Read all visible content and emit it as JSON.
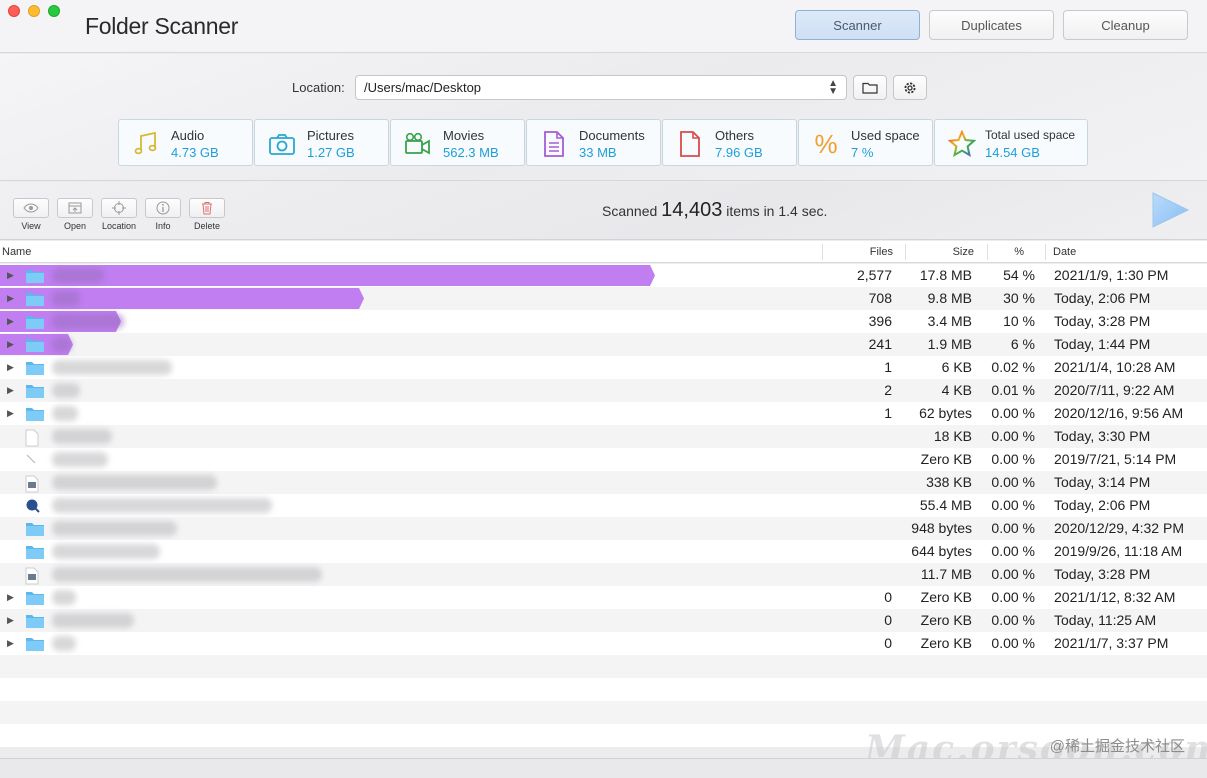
{
  "window": {
    "title": "Folder Scanner",
    "tabs": [
      {
        "label": "Scanner",
        "active": true
      },
      {
        "label": "Duplicates",
        "active": false
      },
      {
        "label": "Cleanup",
        "active": false
      }
    ]
  },
  "location": {
    "label": "Location:",
    "value": "/Users/mac/Desktop"
  },
  "categories": [
    {
      "name": "Audio",
      "value": "4.73 GB",
      "icon": "music-note-icon"
    },
    {
      "name": "Pictures",
      "value": "1.27 GB",
      "icon": "camera-icon"
    },
    {
      "name": "Movies",
      "value": "562.3 MB",
      "icon": "video-camera-icon"
    },
    {
      "name": "Documents",
      "value": "33 MB",
      "icon": "document-icon"
    },
    {
      "name": "Others",
      "value": "7.96 GB",
      "icon": "file-icon"
    },
    {
      "name": "Used space",
      "value": "7 %",
      "icon": "percent-icon"
    },
    {
      "name": "Total used space",
      "value": "14.54 GB",
      "icon": "star-icon"
    }
  ],
  "toolbar": {
    "view": "View",
    "open": "Open",
    "location": "Location",
    "info": "Info",
    "delete": "Delete"
  },
  "scan": {
    "prefix": "Scanned",
    "count": "14,403",
    "suffix": "items in 1.4 sec."
  },
  "table": {
    "headers": {
      "name": "Name",
      "files": "Files",
      "size": "Size",
      "pct": "%",
      "date": "Date"
    },
    "rows": [
      {
        "expandable": true,
        "type": "folder",
        "files": "2,577",
        "size": "17.8 MB",
        "pct": "54 %",
        "date": "2021/1/9, 1:30 PM",
        "share": 0.54
      },
      {
        "expandable": true,
        "type": "folder",
        "files": "708",
        "size": "9.8 MB",
        "pct": "30 %",
        "date": "Today, 2:06 PM",
        "share": 0.3
      },
      {
        "expandable": true,
        "type": "folder",
        "files": "396",
        "size": "3.4 MB",
        "pct": "10 %",
        "date": "Today, 3:28 PM",
        "share": 0.1
      },
      {
        "expandable": true,
        "type": "folder",
        "files": "241",
        "size": "1.9 MB",
        "pct": "6 %",
        "date": "Today, 1:44 PM",
        "share": 0.06
      },
      {
        "expandable": true,
        "type": "folder",
        "files": "1",
        "size": "6 KB",
        "pct": "0.02 %",
        "date": "2021/1/4, 10:28 AM",
        "share": 0
      },
      {
        "expandable": true,
        "type": "folder",
        "files": "2",
        "size": "4 KB",
        "pct": "0.01 %",
        "date": "2020/7/11, 9:22 AM",
        "share": 0
      },
      {
        "expandable": true,
        "type": "folder",
        "files": "1",
        "size": "62 bytes",
        "pct": "0.00 %",
        "date": "2020/12/16, 9:56 AM",
        "share": 0
      },
      {
        "expandable": false,
        "type": "file",
        "files": "",
        "size": "18 KB",
        "pct": "0.00 %",
        "date": "Today, 3:30 PM",
        "share": 0
      },
      {
        "expandable": false,
        "type": "alias",
        "files": "",
        "size": "Zero KB",
        "pct": "0.00 %",
        "date": "2019/7/21, 5:14 PM",
        "share": 0
      },
      {
        "expandable": false,
        "type": "image",
        "files": "",
        "size": "338 KB",
        "pct": "0.00 %",
        "date": "Today, 3:14 PM",
        "share": 0
      },
      {
        "expandable": false,
        "type": "video",
        "files": "",
        "size": "55.4 MB",
        "pct": "0.00 %",
        "date": "Today, 2:06 PM",
        "share": 0
      },
      {
        "expandable": false,
        "type": "folder",
        "files": "",
        "size": "948 bytes",
        "pct": "0.00 %",
        "date": "2020/12/29, 4:32 PM",
        "share": 0
      },
      {
        "expandable": false,
        "type": "folder",
        "files": "",
        "size": "644 bytes",
        "pct": "0.00 %",
        "date": "2019/9/26, 11:18 AM",
        "share": 0
      },
      {
        "expandable": false,
        "type": "image",
        "files": "",
        "size": "11.7 MB",
        "pct": "0.00 %",
        "date": "Today, 3:28 PM",
        "share": 0
      },
      {
        "expandable": true,
        "type": "folder",
        "files": "0",
        "size": "Zero KB",
        "pct": "0.00 %",
        "date": "2021/1/12, 8:32 AM",
        "share": 0
      },
      {
        "expandable": true,
        "type": "folder",
        "files": "0",
        "size": "Zero KB",
        "pct": "0.00 %",
        "date": "Today, 11:25 AM",
        "share": 0
      },
      {
        "expandable": true,
        "type": "folder",
        "files": "0",
        "size": "Zero KB",
        "pct": "0.00 %",
        "date": "2021/1/7, 3:37 PM",
        "share": 0
      }
    ]
  },
  "watermark": "@稀土掘金技术社区",
  "watermark_brand": "Mac.orsoon.com",
  "colors": {
    "accent": "#1e9ed9",
    "bar": "#c07ef0",
    "folder": "#5ab8ef"
  }
}
